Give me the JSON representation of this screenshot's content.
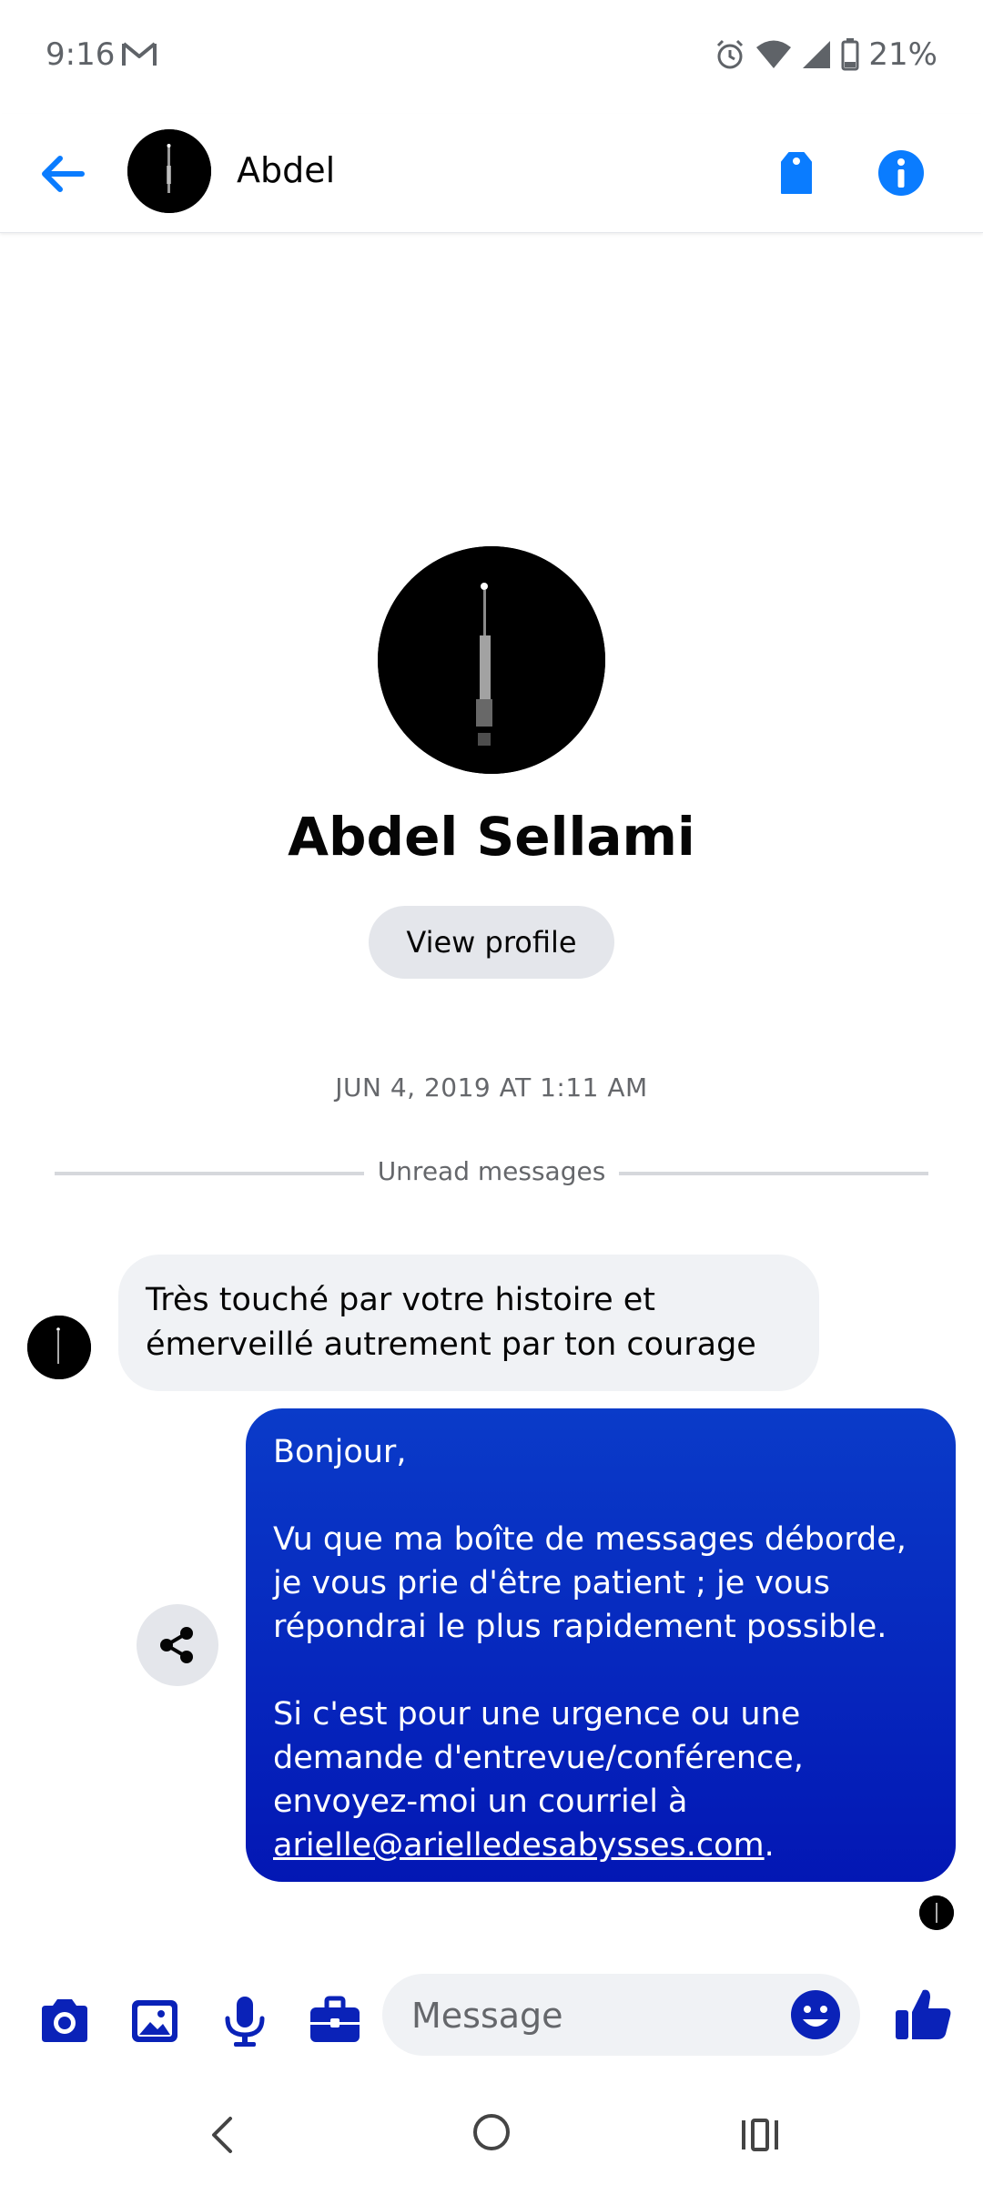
{
  "status_bar": {
    "time": "9:16",
    "battery": "21%",
    "icons": [
      "gmail-icon",
      "alarm-icon",
      "wifi-icon",
      "signal-icon",
      "battery-icon"
    ]
  },
  "header": {
    "contact_name": "Abdel",
    "icons": [
      "back-arrow-icon",
      "tag-icon",
      "info-icon"
    ]
  },
  "profile": {
    "full_name": "Abdel Sellami",
    "view_profile_label": "View profile"
  },
  "conversation": {
    "date_stamp": "JUN 4, 2019 AT 1:11 AM",
    "unread_label": "Unread messages",
    "incoming_message": "Très touché par votre histoire et émerveillé autrement par ton courage",
    "outgoing_message": {
      "greeting": "Bonjour,",
      "paragraph_1": "Vu que ma boîte de messages déborde, je vous prie d'être patient ; je vous répondrai le plus rapidement possible.",
      "paragraph_2": "Si c'est pour une urgence ou une demande d'entrevue/conférence, envoyez-moi un courriel à",
      "email": "arielle@arielledesabysses.com",
      "trailing": "."
    }
  },
  "composer": {
    "placeholder": "Message",
    "icons": [
      "camera-icon",
      "gallery-icon",
      "microphone-icon",
      "briefcase-icon",
      "emoji-icon",
      "thumbs-up-icon"
    ]
  },
  "colors": {
    "accent": "#0a7cff",
    "composer_icon": "#0a22b8",
    "bubble_outgoing": "#0a3bc9",
    "bubble_incoming": "#f0f2f5"
  }
}
